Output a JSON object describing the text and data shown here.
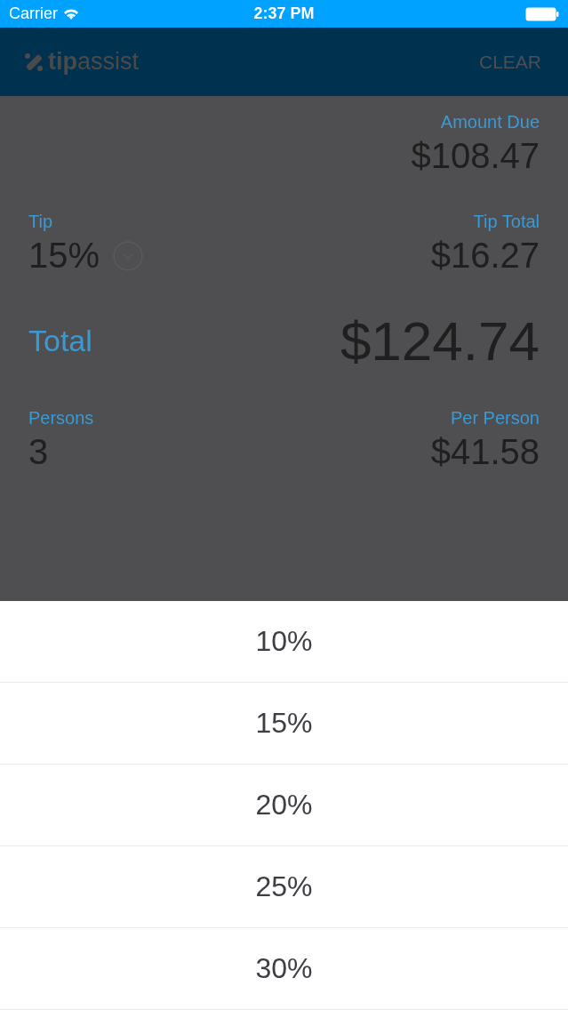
{
  "status_bar": {
    "carrier": "Carrier",
    "time": "2:37 PM"
  },
  "header": {
    "logo": "**tip**assist",
    "action": "CLEAR"
  },
  "amount_due": {
    "label": "Amount Due",
    "value": "$108.47"
  },
  "tip": {
    "label": "Tip",
    "value": "15%"
  },
  "tip_total": {
    "label": "Tip Total",
    "value": "$16.27"
  },
  "total": {
    "label": "Total",
    "value": "$124.74"
  },
  "persons": {
    "label": "Persons",
    "value": "3"
  },
  "per_person": {
    "label": "Per Person",
    "value": "$41.58"
  },
  "tip_options": [
    {
      "label": "10%"
    },
    {
      "label": "15%"
    },
    {
      "label": "20%"
    },
    {
      "label": "25%"
    },
    {
      "label": "30%"
    }
  ]
}
